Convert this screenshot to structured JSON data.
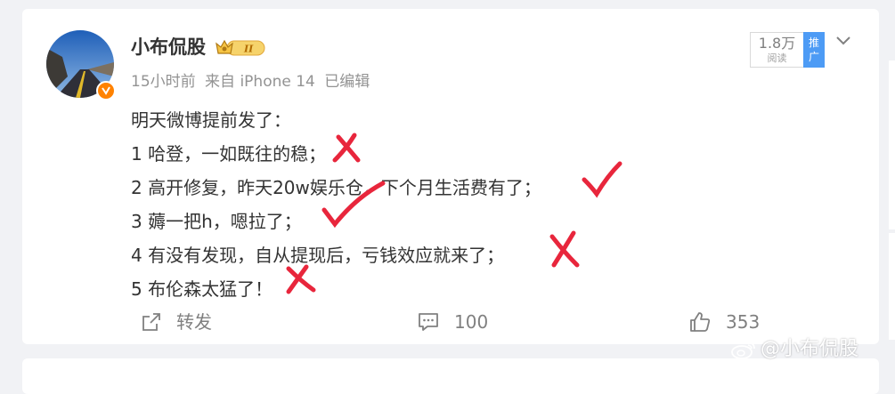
{
  "post": {
    "author": "小布侃股",
    "vip_level": "II",
    "time": "15小时前",
    "source": "来自 iPhone 14",
    "edited": "已编辑",
    "views_count": "1.8万",
    "views_label": "阅读",
    "promote_label": "推广",
    "content_lines": [
      "明天微博提前发了：",
      "1 哈登，一如既往的稳；",
      "2 高开修复，昨天20w娱乐仓，下个月生活费有了；",
      "3 薅一把h，嗯拉了；",
      "4 有没有发现，自从提现后，亏钱效应就来了；",
      "5 布伦森太猛了！"
    ]
  },
  "actions": {
    "repost_label": "转发",
    "comment_count": "100",
    "like_count": "353"
  },
  "watermark": {
    "text": "@小布侃股"
  },
  "colors": {
    "accent_orange": "#ff8200",
    "promote_blue": "#4d9bf5",
    "mark_red": "#e8263c"
  }
}
